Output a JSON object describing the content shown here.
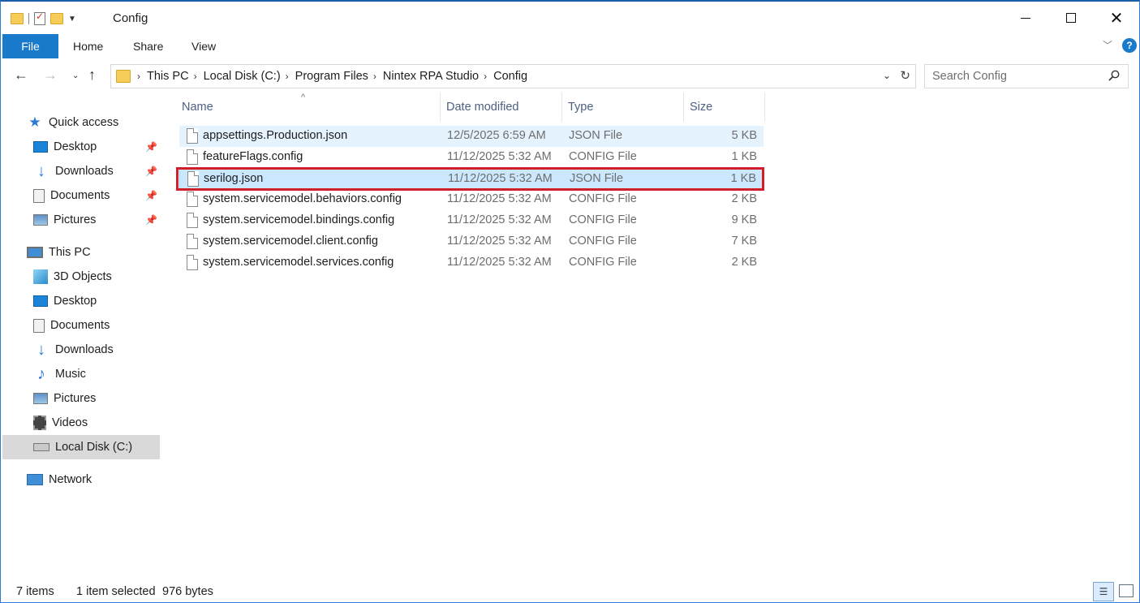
{
  "window": {
    "title": "Config"
  },
  "ribbon": {
    "file": "File",
    "home": "Home",
    "share": "Share",
    "view": "View",
    "help": "?"
  },
  "address": {
    "crumbs": [
      "This PC",
      "Local Disk (C:)",
      "Program Files",
      "Nintex RPA Studio",
      "Config"
    ]
  },
  "search": {
    "placeholder": "Search Config"
  },
  "sidebar": {
    "items": [
      {
        "label": "Quick access",
        "icon": "star-icon"
      },
      {
        "label": "Desktop",
        "icon": "desktop-icon",
        "pinned": true
      },
      {
        "label": "Downloads",
        "icon": "download-icon",
        "pinned": true
      },
      {
        "label": "Documents",
        "icon": "document-icon",
        "pinned": true
      },
      {
        "label": "Pictures",
        "icon": "pictures-icon",
        "pinned": true
      },
      {
        "label": "This PC",
        "icon": "computer-icon"
      },
      {
        "label": "3D Objects",
        "icon": "3d-objects-icon"
      },
      {
        "label": "Desktop",
        "icon": "desktop-icon"
      },
      {
        "label": "Documents",
        "icon": "document-icon"
      },
      {
        "label": "Downloads",
        "icon": "download-icon"
      },
      {
        "label": "Music",
        "icon": "music-icon"
      },
      {
        "label": "Pictures",
        "icon": "pictures-icon"
      },
      {
        "label": "Videos",
        "icon": "videos-icon"
      },
      {
        "label": "Local Disk (C:)",
        "icon": "disk-icon",
        "selected": true
      },
      {
        "label": "Network",
        "icon": "network-icon"
      }
    ]
  },
  "columns": {
    "name": "Name",
    "date": "Date modified",
    "type": "Type",
    "size": "Size"
  },
  "files": [
    {
      "name": "appsettings.Production.json",
      "date": "12/5/2025 6:59 AM",
      "type": "JSON File",
      "size": "5 KB"
    },
    {
      "name": "featureFlags.config",
      "date": "11/12/2025 5:32 AM",
      "type": "CONFIG File",
      "size": "1 KB"
    },
    {
      "name": "serilog.json",
      "date": "11/12/2025 5:32 AM",
      "type": "JSON File",
      "size": "1 KB",
      "selected": true
    },
    {
      "name": "system.servicemodel.behaviors.config",
      "date": "11/12/2025 5:32 AM",
      "type": "CONFIG File",
      "size": "2 KB"
    },
    {
      "name": "system.servicemodel.bindings.config",
      "date": "11/12/2025 5:32 AM",
      "type": "CONFIG File",
      "size": "9 KB"
    },
    {
      "name": "system.servicemodel.client.config",
      "date": "11/12/2025 5:32 AM",
      "type": "CONFIG File",
      "size": "7 KB"
    },
    {
      "name": "system.servicemodel.services.config",
      "date": "11/12/2025 5:32 AM",
      "type": "CONFIG File",
      "size": "2 KB"
    }
  ],
  "status": {
    "count": "7 items",
    "selection": "1 item selected",
    "size": "976 bytes"
  },
  "colors": {
    "accent": "#1979ca",
    "highlight": "#d21e2b",
    "selection": "#cce8ff",
    "hover": "#e5f3ff"
  }
}
